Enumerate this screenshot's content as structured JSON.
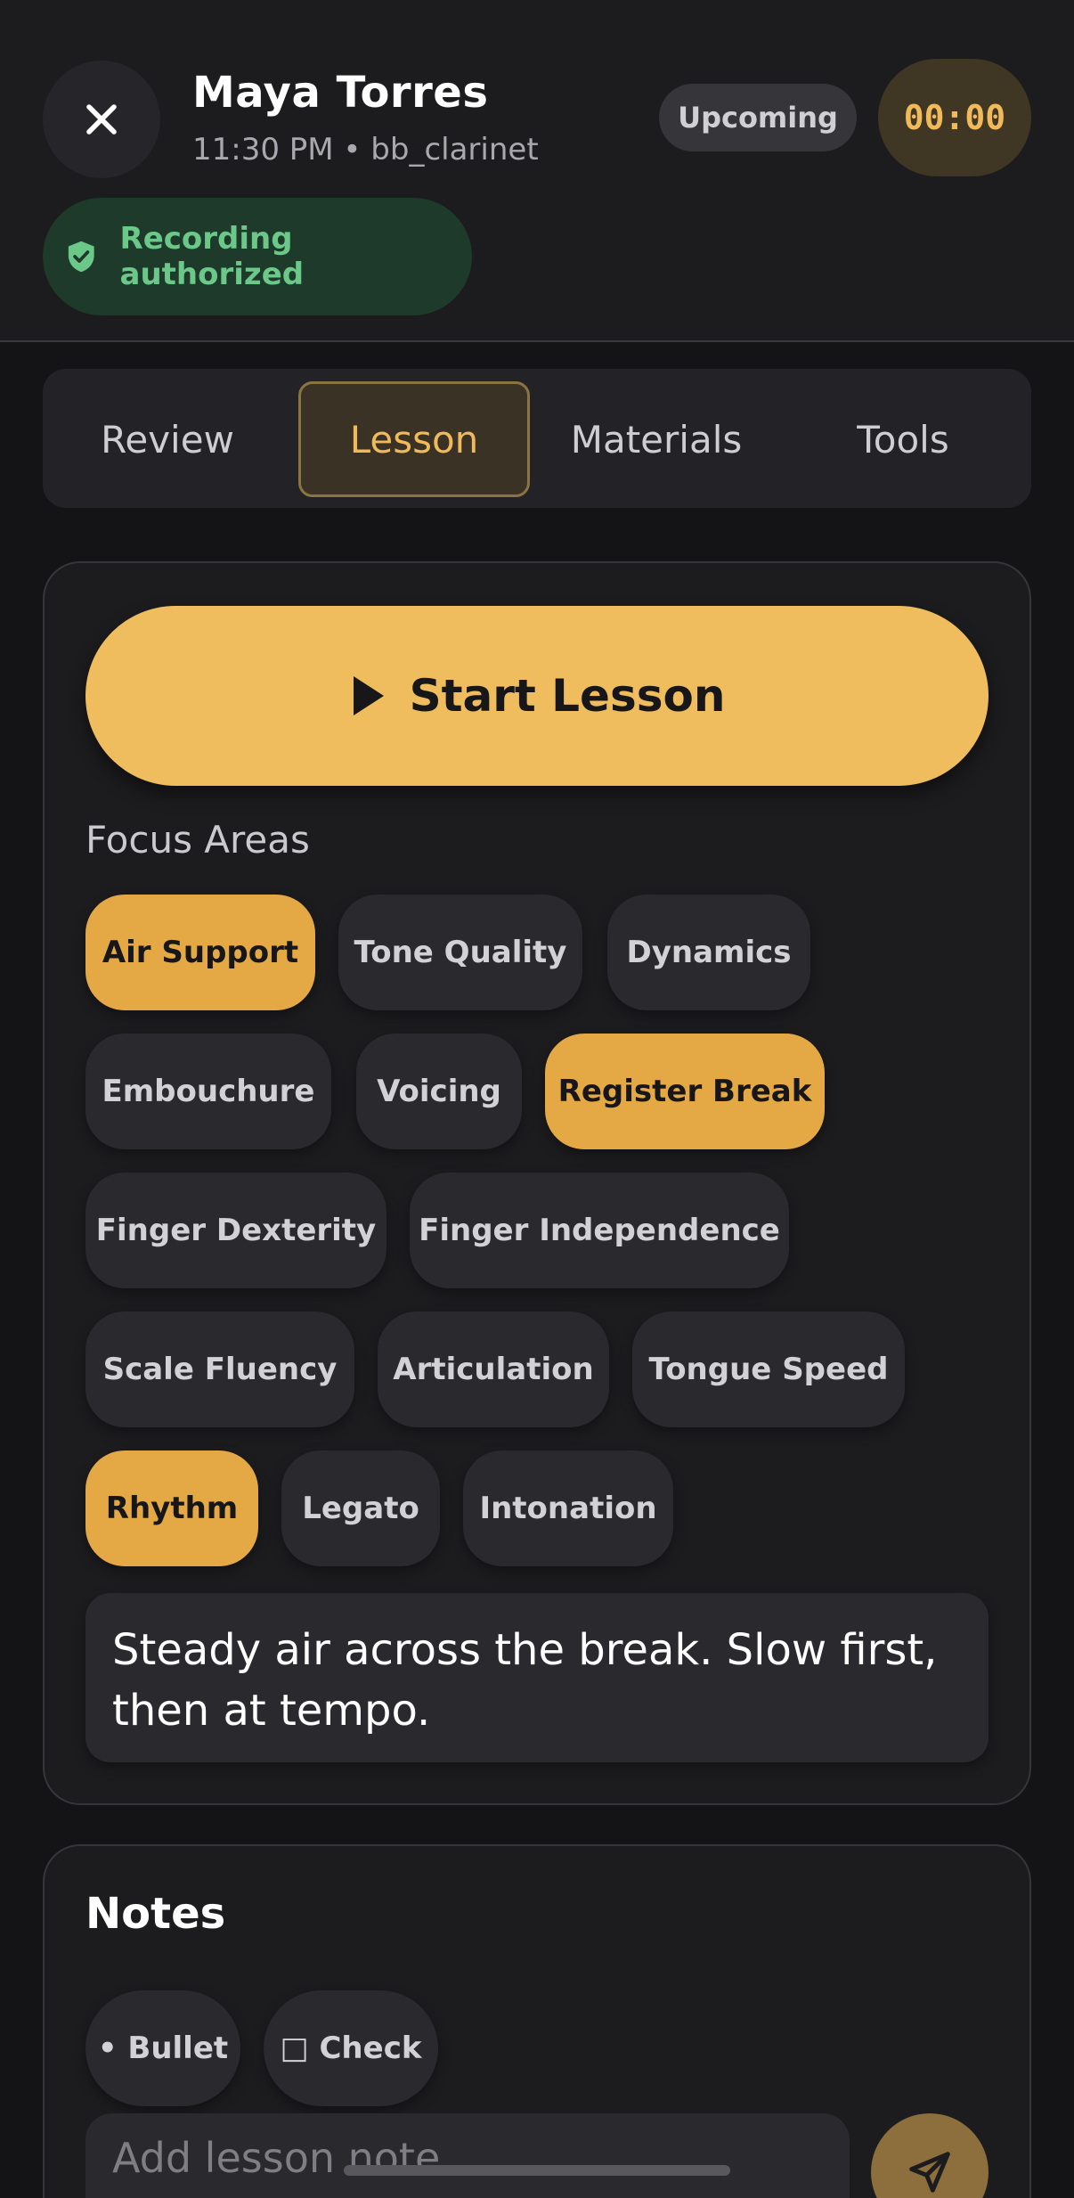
{
  "header": {
    "student_name": "Maya Torres",
    "meta": "11:30 PM • bb_clarinet",
    "status": "Upcoming",
    "timer": "00:00",
    "recording": "Recording authorized"
  },
  "tabs": [
    "Review",
    "Lesson",
    "Materials",
    "Tools"
  ],
  "active_tab": "Lesson",
  "lesson": {
    "start_label": "Start Lesson",
    "focus_title": "Focus Areas",
    "focus_areas": [
      {
        "label": "Air Support",
        "selected": true
      },
      {
        "label": "Tone Quality",
        "selected": false
      },
      {
        "label": "Dynamics",
        "selected": false
      },
      {
        "label": "Embouchure",
        "selected": false
      },
      {
        "label": "Voicing",
        "selected": false
      },
      {
        "label": "Register Break",
        "selected": true
      },
      {
        "label": "Finger Dexterity",
        "selected": false
      },
      {
        "label": "Finger Independence",
        "selected": false
      },
      {
        "label": "Scale Fluency",
        "selected": false
      },
      {
        "label": "Articulation",
        "selected": false
      },
      {
        "label": "Tongue Speed",
        "selected": false
      },
      {
        "label": "Rhythm",
        "selected": true
      },
      {
        "label": "Legato",
        "selected": false
      },
      {
        "label": "Intonation",
        "selected": false
      }
    ],
    "focus_note": "Steady air across the break. Slow first, then at tempo."
  },
  "notes": {
    "title": "Notes",
    "bullet_label": "• Bullet",
    "check_label": "□ Check",
    "input_placeholder": "Add lesson note"
  },
  "colors": {
    "accent": "#efbd5e",
    "chip_selected": "#e4a844",
    "success": "#6cc889",
    "background": "#141416"
  }
}
